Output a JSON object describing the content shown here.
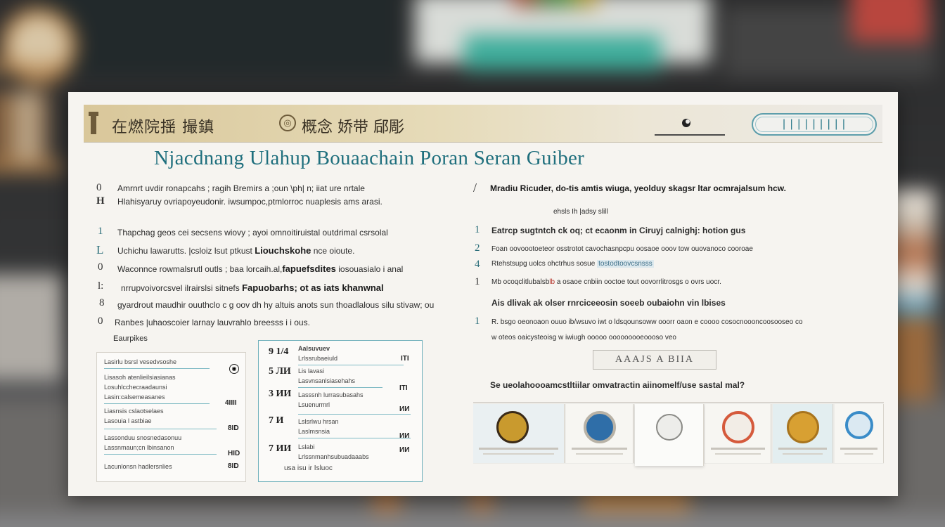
{
  "topbar": {
    "title": "在燃院揺 撮鎮",
    "title2": "概念 娇带 郈彫",
    "badge_text": "|||||||||"
  },
  "heading": "Njacdnang Ulahup Bouaachain Poran Seran Guiber",
  "left_column": {
    "intro": [
      {
        "marker": "0",
        "text": "Amrnrt uvdir ronapcahs  ;  ragih Bremirs a ;oun \\ph| n; iiat ure nrtale"
      },
      {
        "marker": "H",
        "text": "Hlahisyaruy ovriapoyeudonir.  iwsumpoc,ptmlorroc nuaplesis ams arasi."
      }
    ],
    "items": [
      {
        "marker": "1",
        "text": "Thapchag geos cei secsens wiovy ; ayoi omnoitiruistal outdrimal csrsolal",
        "bold": ""
      },
      {
        "marker": "L",
        "text": "Uchichu      lawarutts.      |csloiz lsut ptkust   ",
        "bold": "Liouchskohe",
        "tail": " nce oioute."
      },
      {
        "marker": "0",
        "text": "Waconnce rowmalsrutl outls   ;   baa lorcaih.al,",
        "bold": "fapuefsdites",
        "tail": "       iosouasialo i anal"
      },
      {
        "marker": "l:",
        "text": "nrrupvoivorcsvel  ilrairslsi sitnefs",
        "bold": "Fapuobarhs; ot as iats khanwnal",
        "tail": ""
      },
      {
        "marker": "8",
        "text": "  gyardrout maudhir  ouuthclo c g oov dh  hy altuis  anots sun thoadlalous silu stivaw; ou",
        "bold": ""
      },
      {
        "marker": "0",
        "text": "Ranbes  |uhaoscoier       larnay        lauvrahlo   breesss  i   i ous.",
        "bold": ""
      }
    ],
    "caption": "Eaurpikes"
  },
  "card1": {
    "rows": [
      "Lasirlu bsrsl vesedvsoshe",
      "Lisasoh atenlieilsiasianas",
      "Losuhlcchecraadaunsi",
      "Lasin:calsemeasanes",
      "Liasnsis cslaotselaes",
      "Lasouia l astbiae",
      "Lassonduu snosnedasonuu",
      "Lassnmaun;cn lbinsanon",
      "Lacunlonsn hadlersnlies"
    ],
    "values": [
      "4IIII",
      "8ID",
      "HID",
      "8ID"
    ]
  },
  "card2": {
    "labels": [
      "9 1/4",
      "5 ЛИ",
      "3 ИИ",
      "7 И",
      "7 ИИ"
    ],
    "header": "Aalsuvuev",
    "rows": [
      "Lrlssrubaeiuld",
      "Lis lavasi",
      "Lasvnsanlsiasehahs",
      "Lasssnh    lurrasubasahs",
      "Lsuenurmrl",
      "Lslsrlwu hrsan",
      "Laslmsnsia",
      "Lslabi",
      "Lrlssnmanhsubuadaaabs"
    ],
    "values": [
      "ITI",
      "ITI",
      "ИИ",
      "ИИ",
      "ИИ"
    ],
    "footer": "usa isu ir Isluoc"
  },
  "right_column": {
    "lead_marker": "/",
    "lead": "Mradiu  Ricuder,  do-tis amtis wiuga,  yeolduy skagsr ltar ocmrajalsum  hcw.",
    "sub": "ehsls  Ih  |adsy slill",
    "items": [
      {
        "marker": "1",
        "text": "Eatrcp sugtntch ck oq;  ct ecaonm in Ciruyj calnighj:  hotion gus"
      },
      {
        "marker": "2",
        "text": "Foan oovoootoeteor  osstrotot cavochasnpcpu oosaoe    ooov      tow  ouovanoco cooroae"
      },
      {
        "marker": "4",
        "text": "Rtehstsupg uolcs   ohctrhus   sosue",
        "hl": "tostodtoovcsnsss"
      },
      {
        "marker": "1",
        "text": "Mb ocoqclitlubalsb",
        "red": "lb",
        "tail": "    a osaoe cnbiin   ooctoe  tout oovorrlitrosgs o ovrs uocr."
      },
      {
        "marker": "",
        "text": "Ais dlivak ak olser    rnrciceeosin  soeeb oubaiohn  vin lbises",
        "bold": true
      },
      {
        "marker": "1",
        "text": "R. bsgo oeonoaon  ouuo  ib/wsuvo iwt o ldsqounsoww  ooorr oaon e  coooo   cosocnoooncoosooseo     co"
      },
      {
        "marker": "",
        "text": "w oteos  oaicysteoisg  w iwiugh  ooooo              ooooooooeoooso  veo"
      }
    ],
    "button": "AAAJS     A  BIIA",
    "footer": "Se ueolahoooamcstltiilar omvatractin  aiinomelf/use  sastal  mal?"
  },
  "tiles": [
    {
      "icon": "coin-icon",
      "color": "#c99a2e"
    },
    {
      "icon": "globe-icon",
      "color": "#2f6ea8"
    },
    {
      "icon": "clock-icon",
      "color": "#d7d7d4"
    },
    {
      "icon": "badge-icon",
      "color": "#d55a3c"
    },
    {
      "icon": "shield-icon",
      "color": "#d8a032"
    },
    {
      "icon": "ring-icon",
      "color": "#3a8cc8"
    }
  ]
}
